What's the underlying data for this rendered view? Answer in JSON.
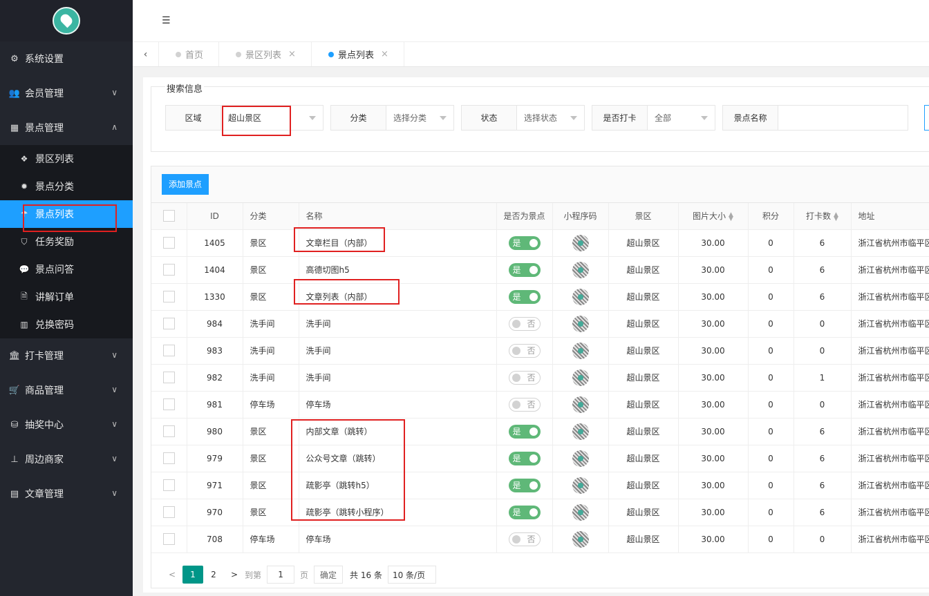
{
  "sidebar": {
    "menu": [
      {
        "label": "系统设置",
        "icon": "gears-icon",
        "chev": ""
      },
      {
        "label": "会员管理",
        "icon": "users-icon",
        "chev": "﹀"
      },
      {
        "label": "景点管理",
        "icon": "grid-icon",
        "chev": "︿"
      }
    ],
    "sub": [
      {
        "label": "景区列表",
        "icon": "cubes-icon"
      },
      {
        "label": "景点分类",
        "icon": "gear-icon"
      },
      {
        "label": "景点列表",
        "icon": "umbrella-icon"
      },
      {
        "label": "任务奖励",
        "icon": "shield-icon"
      },
      {
        "label": "景点问答",
        "icon": "chat-icon"
      },
      {
        "label": "讲解订单",
        "icon": "audio-file-icon"
      },
      {
        "label": "兑换密码",
        "icon": "barcode-icon"
      }
    ],
    "menu2": [
      {
        "label": "打卡管理",
        "icon": "bank-icon"
      },
      {
        "label": "商品管理",
        "icon": "cart-icon"
      },
      {
        "label": "抽奖中心",
        "icon": "database-icon"
      },
      {
        "label": "周边商家",
        "icon": "sitemap-icon"
      },
      {
        "label": "文章管理",
        "icon": "newspaper-icon"
      }
    ]
  },
  "tabs": [
    {
      "label": "首页"
    },
    {
      "label": "景区列表"
    },
    {
      "label": "景点列表"
    }
  ],
  "search": {
    "legend": "搜索信息",
    "area_label": "区域",
    "area_value": "超山景区",
    "category_label": "分类",
    "category_value": "选择分类",
    "status_label": "状态",
    "status_value": "选择状态",
    "checkin_label": "是否打卡",
    "checkin_value": "全部",
    "name_label": "景点名称",
    "name_value": ""
  },
  "toolbar": {
    "add_label": "添加景点"
  },
  "table": {
    "headers": [
      "ID",
      "分类",
      "名称",
      "是否为景点",
      "小程序码",
      "景区",
      "图片大小",
      "积分",
      "打卡数",
      "地址"
    ],
    "on_label": "是",
    "off_label": "否",
    "rows": [
      {
        "id": "1405",
        "cat": "景区",
        "name": "文章栏目（内部）",
        "on": true,
        "area": "超山景区",
        "size": "30.00",
        "points": "0",
        "checkins": "6",
        "addr": "浙江省杭州市临平区"
      },
      {
        "id": "1404",
        "cat": "景区",
        "name": "高德切图h5",
        "on": true,
        "area": "超山景区",
        "size": "30.00",
        "points": "0",
        "checkins": "6",
        "addr": "浙江省杭州市临平区"
      },
      {
        "id": "1330",
        "cat": "景区",
        "name": "文章列表（内部）",
        "on": true,
        "area": "超山景区",
        "size": "30.00",
        "points": "0",
        "checkins": "6",
        "addr": "浙江省杭州市临平区"
      },
      {
        "id": "984",
        "cat": "洗手间",
        "name": "洗手间",
        "on": false,
        "area": "超山景区",
        "size": "30.00",
        "points": "0",
        "checkins": "0",
        "addr": "浙江省杭州市临平区"
      },
      {
        "id": "983",
        "cat": "洗手间",
        "name": "洗手间",
        "on": false,
        "area": "超山景区",
        "size": "30.00",
        "points": "0",
        "checkins": "0",
        "addr": "浙江省杭州市临平区"
      },
      {
        "id": "982",
        "cat": "洗手间",
        "name": "洗手间",
        "on": false,
        "area": "超山景区",
        "size": "30.00",
        "points": "0",
        "checkins": "1",
        "addr": "浙江省杭州市临平区"
      },
      {
        "id": "981",
        "cat": "停车场",
        "name": "停车场",
        "on": false,
        "area": "超山景区",
        "size": "30.00",
        "points": "0",
        "checkins": "0",
        "addr": "浙江省杭州市临平区"
      },
      {
        "id": "980",
        "cat": "景区",
        "name": "内部文章（跳转）",
        "on": true,
        "area": "超山景区",
        "size": "30.00",
        "points": "0",
        "checkins": "6",
        "addr": "浙江省杭州市临平区"
      },
      {
        "id": "979",
        "cat": "景区",
        "name": "公众号文章（跳转）",
        "on": true,
        "area": "超山景区",
        "size": "30.00",
        "points": "0",
        "checkins": "6",
        "addr": "浙江省杭州市临平区"
      },
      {
        "id": "971",
        "cat": "景区",
        "name": "疏影亭（跳转h5）",
        "on": true,
        "area": "超山景区",
        "size": "30.00",
        "points": "0",
        "checkins": "6",
        "addr": "浙江省杭州市临平区"
      },
      {
        "id": "970",
        "cat": "景区",
        "name": "疏影亭（跳转小程序）",
        "on": true,
        "area": "超山景区",
        "size": "30.00",
        "points": "0",
        "checkins": "6",
        "addr": "浙江省杭州市临平区"
      },
      {
        "id": "708",
        "cat": "停车场",
        "name": "停车场",
        "on": false,
        "area": "超山景区",
        "size": "30.00",
        "points": "0",
        "checkins": "0",
        "addr": "浙江省杭州市临平区"
      }
    ]
  },
  "pager": {
    "prev": "<",
    "page1": "1",
    "page2": "2",
    "next": ">",
    "goto_label": "到第",
    "goto_value": "1",
    "page_unit": "页",
    "confirm": "确定",
    "total": "共 16 条",
    "per_page": "10 条/页"
  }
}
